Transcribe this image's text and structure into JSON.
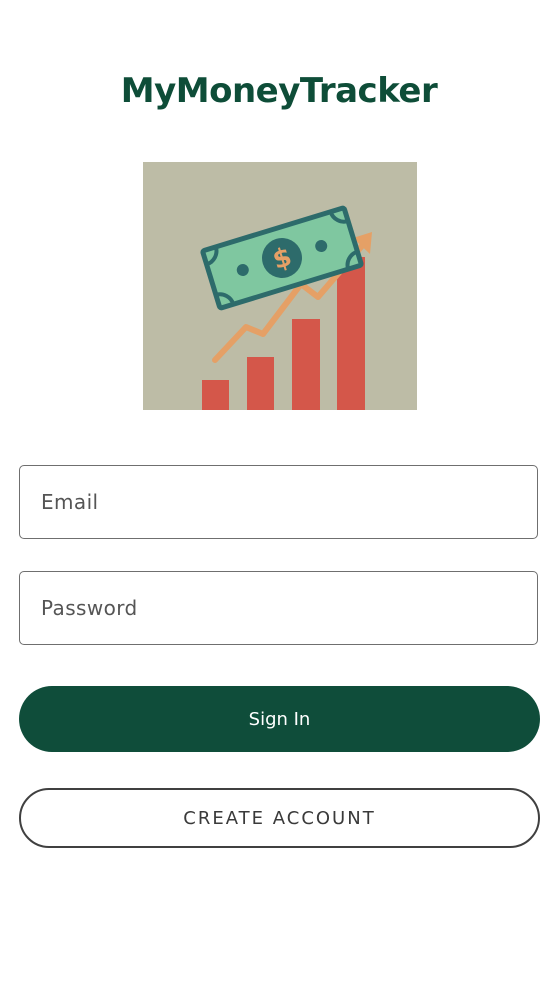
{
  "app": {
    "title": "MyMoneyTracker"
  },
  "hero": {
    "icon": "money-growth-chart-icon"
  },
  "form": {
    "email": {
      "value": "",
      "placeholder": "Email"
    },
    "password": {
      "value": "",
      "placeholder": "Password"
    },
    "sign_in_label": "Sign In",
    "create_account_label": "CREATE ACCOUNT"
  },
  "colors": {
    "brand_green": "#0f4d3a",
    "hero_bg": "#bdbca6",
    "bar_red": "#d4574a",
    "trend_orange": "#e5a066",
    "bill_green": "#7fc7a0",
    "bill_outline": "#2d6b6b"
  }
}
